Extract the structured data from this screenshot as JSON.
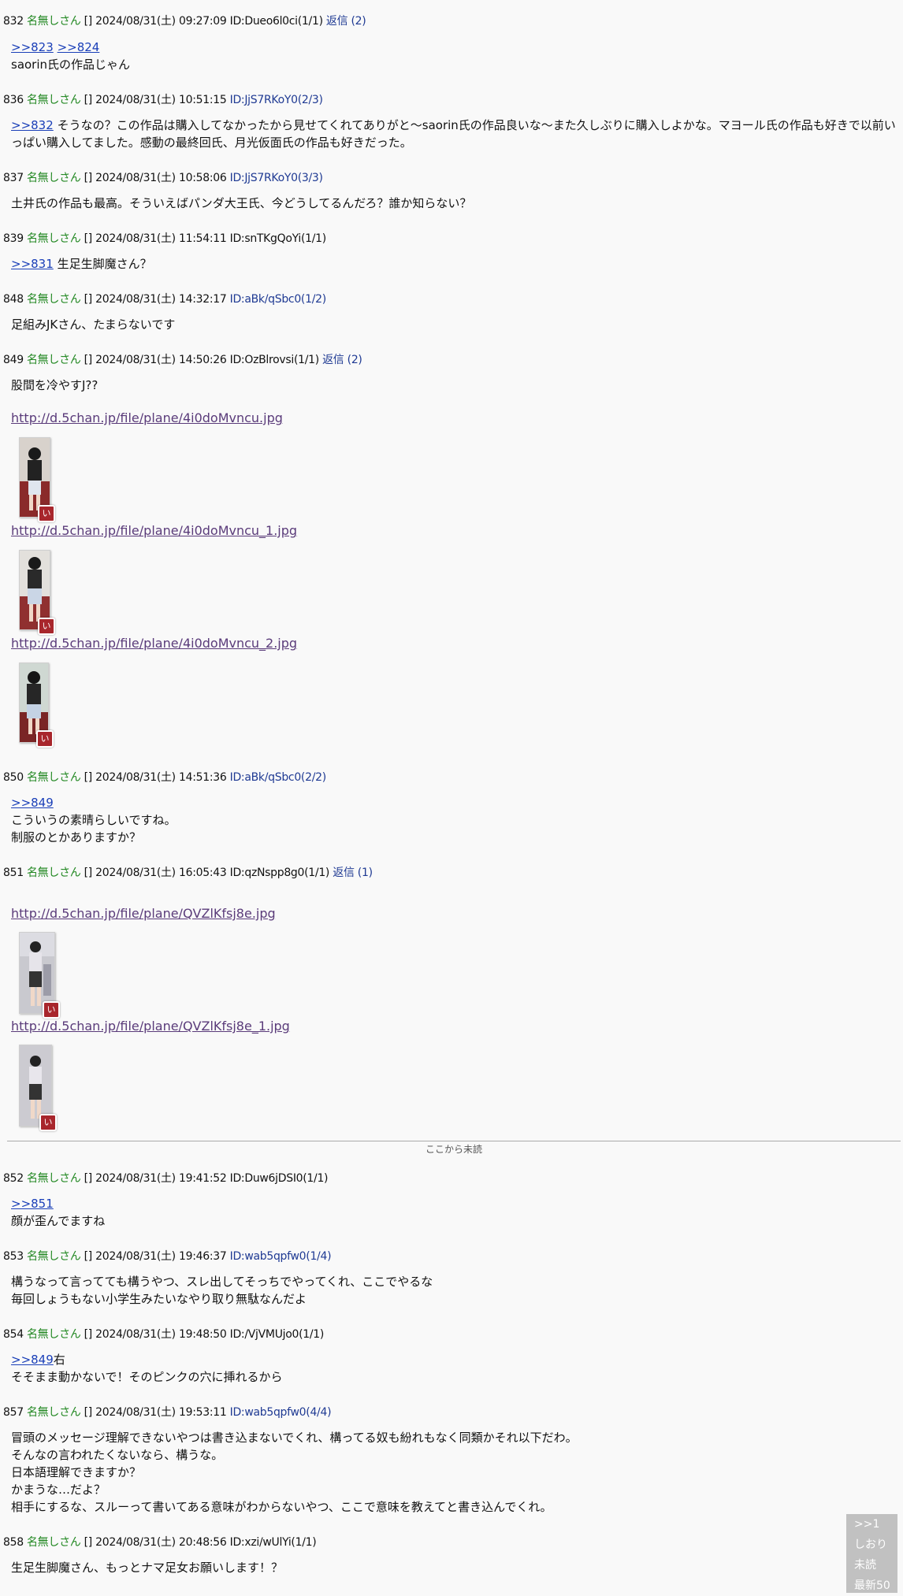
{
  "posts": [
    {
      "num": "832",
      "name": "名無しさん",
      "mail": "[]",
      "date": "2024/08/31(土) 09:27:09",
      "id": "ID:Dueo6l0ci(1/1)",
      "reply": "返信 (2)",
      "anchors": [
        ">>823",
        ">>824"
      ],
      "lines": [
        "saorin氏の作品じゃん"
      ]
    },
    {
      "num": "836",
      "name": "名無しさん",
      "mail": "[]",
      "date": "2024/08/31(土) 10:51:15",
      "id": "ID:JjS7RKoY0(2/3)",
      "anchor": ">>832",
      "lines": [
        "そうなの？この作品は購入してなかったから見せてくれてありがと〜saorin氏の作品良いな〜また久しぶりに購入しよかな。マヨール氏の作品も好きで以前い",
        "っぱい購入してました。感動の最終回氏、月光仮面氏の作品も好きだった。"
      ]
    },
    {
      "num": "837",
      "name": "名無しさん",
      "mail": "[]",
      "date": "2024/08/31(土) 10:58:06",
      "id": "ID:JjS7RKoY0(3/3)",
      "lines": [
        "土井氏の作品も最高。そういえばパンダ大王氏、今どうしてるんだろ？誰か知らない？"
      ]
    },
    {
      "num": "839",
      "name": "名無しさん",
      "mail": "[]",
      "date": "2024/08/31(土) 11:54:11",
      "id": "ID:snTKgQoYi(1/1)",
      "anchor": ">>831",
      "lines": [
        "生足生脚魔さん？"
      ]
    },
    {
      "num": "848",
      "name": "名無しさん",
      "mail": "[]",
      "date": "2024/08/31(土) 14:32:17",
      "id": "ID:aBk/qSbc0(1/2)",
      "lines": [
        "足組みJKさん、たまらないです"
      ]
    },
    {
      "num": "849",
      "name": "名無しさん",
      "mail": "[]",
      "date": "2024/08/31(土) 14:50:26",
      "id": "ID:OzBlrovsi(1/1)",
      "reply": "返信 (2)",
      "lines": [
        "股間を冷やすJ??"
      ],
      "links": [
        "http://d.5chan.jp/file/plane/4i0doMvncu.jpg",
        "http://d.5chan.jp/file/plane/4i0doMvncu_1.jpg",
        "http://d.5chan.jp/file/plane/4i0doMvncu_2.jpg"
      ]
    },
    {
      "num": "850",
      "name": "名無しさん",
      "mail": "[]",
      "date": "2024/08/31(土) 14:51:36",
      "id": "ID:aBk/qSbc0(2/2)",
      "anchor": ">>849",
      "lines": [
        "こういうの素晴らしいですね。",
        "制服のとかありますか？"
      ]
    },
    {
      "num": "851",
      "name": "名無しさん",
      "mail": "[]",
      "date": "2024/08/31(土) 16:05:43",
      "id": "ID:qzNspp8g0(1/1)",
      "reply": "返信 (1)",
      "links": [
        "http://d.5chan.jp/file/plane/QVZlKfsj8e.jpg",
        "http://d.5chan.jp/file/plane/QVZlKfsj8e_1.jpg"
      ]
    },
    {
      "num": "852",
      "name": "名無しさん",
      "mail": "[]",
      "date": "2024/08/31(土) 19:41:52",
      "id": "ID:Duw6jDSI0(1/1)",
      "anchor": ">>851",
      "lines": [
        "顔が歪んでますね"
      ]
    },
    {
      "num": "853",
      "name": "名無しさん",
      "mail": "[]",
      "date": "2024/08/31(土) 19:46:37",
      "id": "ID:wab5qpfw0(1/4)",
      "lines": [
        "構うなって言ってても構うやつ、スレ出してそっちでやってくれ、ここでやるな",
        "毎回しょうもない小学生みたいなやり取り無駄なんだよ"
      ]
    },
    {
      "num": "854",
      "name": "名無しさん",
      "mail": "[]",
      "date": "2024/08/31(土) 19:48:50",
      "id": "ID:/VjVMUjo0(1/1)",
      "anchor": ">>849",
      "anchor_suffix": "右",
      "lines": [
        "そそまま動かないで！そのピンクの穴に挿れるから"
      ]
    },
    {
      "num": "857",
      "name": "名無しさん",
      "mail": "[]",
      "date": "2024/08/31(土) 19:53:11",
      "id": "ID:wab5qpfw0(4/4)",
      "lines": [
        "冒頭のメッセージ理解できないやつは書き込まないでくれ、構ってる奴も紛れもなく同類かそれ以下だわ。",
        "そんなの言われたくないなら、構うな。",
        "日本語理解できますか？",
        "かまうな…だよ？",
        "相手にするな、スルーって書いてある意味がわからないやつ、ここで意味を教えてと書き込んでくれ。"
      ]
    },
    {
      "num": "858",
      "name": "名無しさん",
      "mail": "[]",
      "date": "2024/08/31(土) 20:48:56",
      "id": "ID:xzi/wUlYi(1/1)",
      "lines": [
        "生足生脚魔さん、もっとナマ足女お願いします！？"
      ]
    }
  ],
  "thumb_badge": "い",
  "unread_label": "ここから未読",
  "nav": {
    "first": ">>1",
    "bookmark": "しおり",
    "unread": "未読",
    "latest": "最新50"
  },
  "colors": {
    "name": "#228822",
    "id_link": "#1f3a93",
    "anchor": "#1a3fb8",
    "url": "#5a3b7a",
    "badge": "#a8262c",
    "nav_bg": "#bdbdbd"
  }
}
